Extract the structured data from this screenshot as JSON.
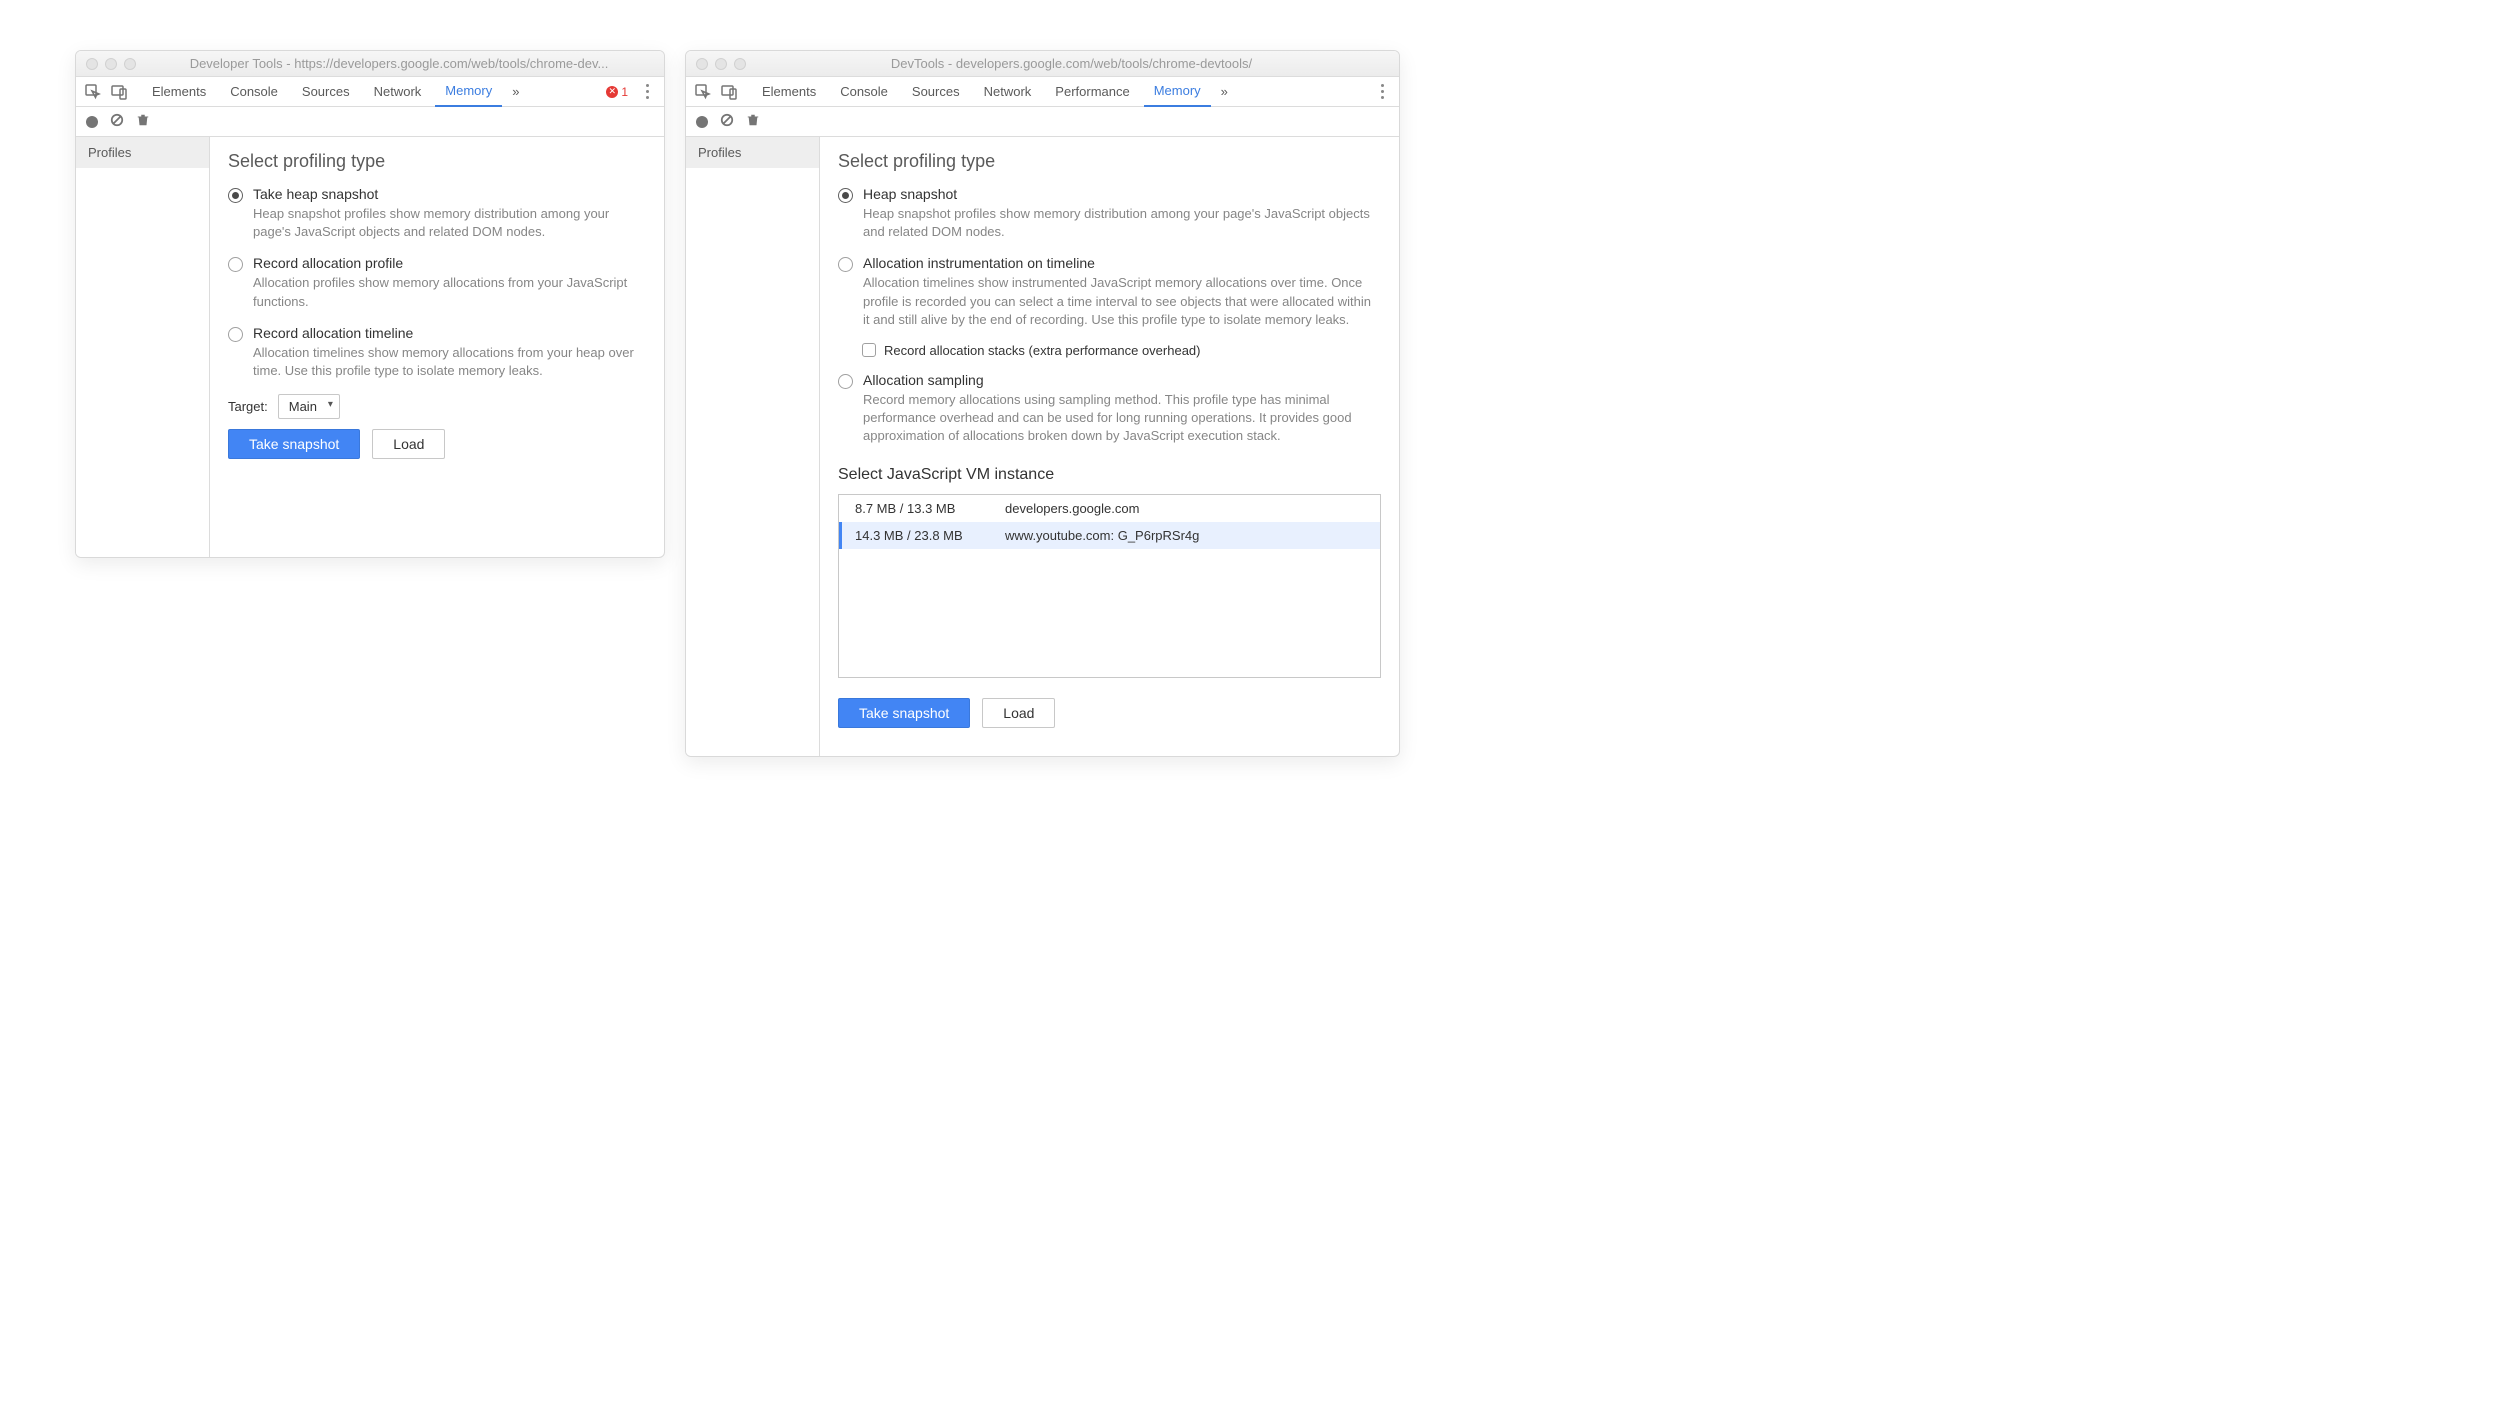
{
  "left": {
    "title": "Developer Tools - https://developers.google.com/web/tools/chrome-dev...",
    "tabs": [
      "Elements",
      "Console",
      "Sources",
      "Network",
      "Memory"
    ],
    "chevron": "»",
    "errcount": "1",
    "sidebar": {
      "profiles": "Profiles"
    },
    "heading": "Select profiling type",
    "opts": [
      {
        "title": "Take heap snapshot",
        "desc": "Heap snapshot profiles show memory distribution among your page's JavaScript objects and related DOM nodes.",
        "selected": true
      },
      {
        "title": "Record allocation profile",
        "desc": "Allocation profiles show memory allocations from your JavaScript functions.",
        "selected": false
      },
      {
        "title": "Record allocation timeline",
        "desc": "Allocation timelines show memory allocations from your heap over time. Use this profile type to isolate memory leaks.",
        "selected": false
      }
    ],
    "target_label": "Target:",
    "target_value": "Main",
    "btn_primary": "Take snapshot",
    "btn_load": "Load"
  },
  "right": {
    "title": "DevTools - developers.google.com/web/tools/chrome-devtools/",
    "tabs": [
      "Elements",
      "Console",
      "Sources",
      "Network",
      "Performance",
      "Memory"
    ],
    "chevron": "»",
    "sidebar": {
      "profiles": "Profiles"
    },
    "heading": "Select profiling type",
    "opts": [
      {
        "title": "Heap snapshot",
        "desc": "Heap snapshot profiles show memory distribution among your page's JavaScript objects and related DOM nodes.",
        "selected": true
      },
      {
        "title": "Allocation instrumentation on timeline",
        "desc": "Allocation timelines show instrumented JavaScript memory allocations over time. Once profile is recorded you can select a time interval to see objects that were allocated within it and still alive by the end of recording. Use this profile type to isolate memory leaks.",
        "selected": false
      },
      {
        "title": "Allocation sampling",
        "desc": "Record memory allocations using sampling method. This profile type has minimal performance overhead and can be used for long running operations. It provides good approximation of allocations broken down by JavaScript execution stack.",
        "selected": false
      }
    ],
    "checkbox_label": "Record allocation stacks (extra performance overhead)",
    "vm_heading": "Select JavaScript VM instance",
    "vm_rows": [
      {
        "mem": "8.7 MB / 13.3 MB",
        "origin": "developers.google.com",
        "selected": false
      },
      {
        "mem": "14.3 MB / 23.8 MB",
        "origin": "www.youtube.com: G_P6rpRSr4g",
        "selected": true
      }
    ],
    "btn_primary": "Take snapshot",
    "btn_load": "Load"
  }
}
